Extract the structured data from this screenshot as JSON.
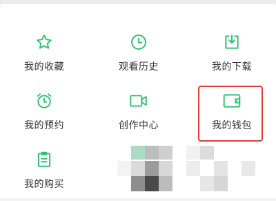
{
  "accent_color": "#2cc46b",
  "highlight_color": "#e23a3a",
  "grid": {
    "items": [
      {
        "label": "我的收藏",
        "icon": "star-icon"
      },
      {
        "label": "观看历史",
        "icon": "clock-icon"
      },
      {
        "label": "我的下载",
        "icon": "download-icon"
      },
      {
        "label": "我的预约",
        "icon": "alarm-clock-icon"
      },
      {
        "label": "创作中心",
        "icon": "video-camera-icon"
      },
      {
        "label": "我的钱包",
        "icon": "wallet-icon"
      },
      {
        "label": "我的购买",
        "icon": "clipboard-icon"
      }
    ]
  }
}
